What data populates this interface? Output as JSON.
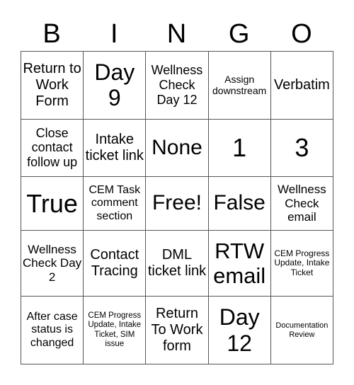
{
  "header": [
    "B",
    "I",
    "N",
    "G",
    "O"
  ],
  "cells": [
    [
      "Return to Work Form",
      "Day 9",
      "Wellness Check Day 12",
      "Assign downstream",
      "Verbatim"
    ],
    [
      "Close contact follow up",
      "Intake ticket link",
      "None",
      "1",
      "3"
    ],
    [
      "True",
      "CEM Task comment section",
      "Free!",
      "False",
      "Wellness Check email"
    ],
    [
      "Wellness Check Day 2",
      "Contact Tracing",
      "DML ticket link",
      "RTW email",
      "CEM Progress Update, Intake Ticket"
    ],
    [
      "After case status is changed",
      "CEM Progress Update, Intake Ticket, SIM issue",
      "Return To Work form",
      "Day 12",
      "Documentation Review"
    ]
  ]
}
